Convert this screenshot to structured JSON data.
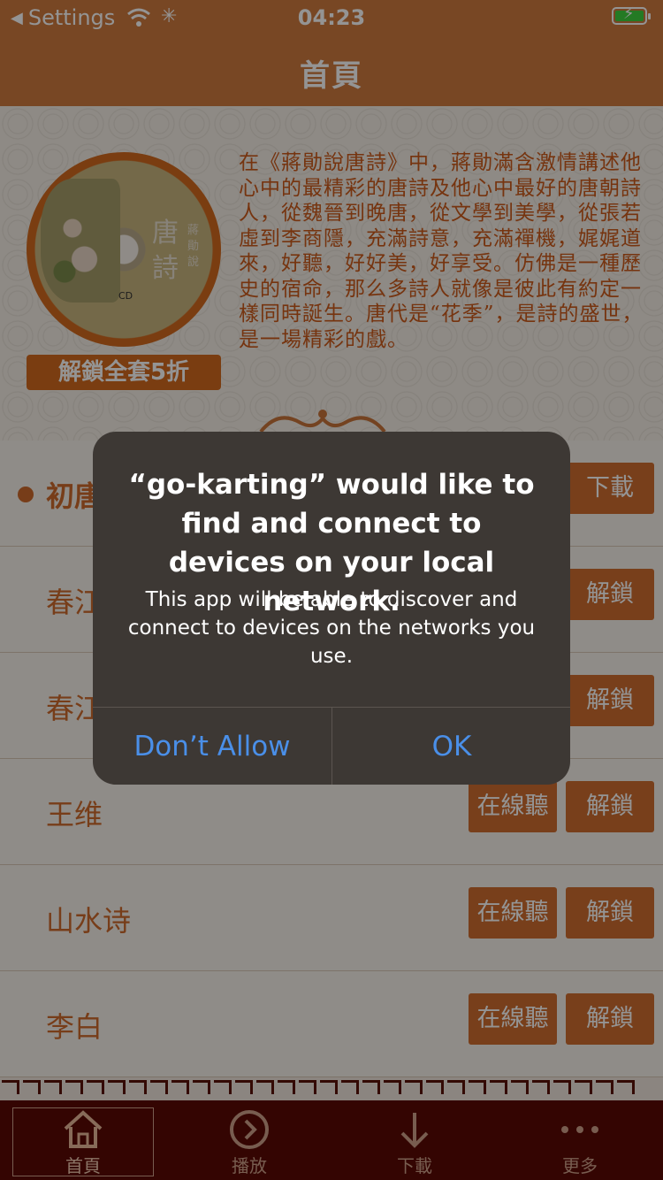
{
  "status_bar": {
    "back_label": "Settings",
    "time": "04:23"
  },
  "nav": {
    "title": "首頁"
  },
  "hero": {
    "cd_title": "唐詩",
    "cd_author": "蔣勛說",
    "cd_label": "CD",
    "unlock_label": "解鎖全套5折",
    "description": "在《蔣勛說唐詩》中，蔣勛滿含激情講述他心中的最精彩的唐詩及他心中最好的唐朝詩人，從魏晉到晚唐，從文學到美學，從張若虛到李商隱，充滿詩意，充滿禪機，娓娓道來，好聽，好好美，好享受。仿佛是一種歷史的宿命，那么多詩人就像是彼此有約定一樣同時誕生。唐代是“花季”，是詩的盛世，是一場精彩的戲。"
  },
  "list": {
    "items": [
      {
        "title": "初唐",
        "buttons": [
          "下載"
        ]
      },
      {
        "title": "春江",
        "buttons": [
          "解鎖"
        ]
      },
      {
        "title": "春江",
        "buttons": [
          "解鎖"
        ]
      },
      {
        "title": "王维",
        "buttons": [
          "在線聽",
          "解鎖"
        ]
      },
      {
        "title": "山水诗",
        "buttons": [
          "在線聽",
          "解鎖"
        ]
      },
      {
        "title": "李白",
        "buttons": [
          "在線聽",
          "解鎖"
        ]
      }
    ]
  },
  "tabbar": {
    "tabs": [
      {
        "label": "首頁",
        "icon": "home-icon"
      },
      {
        "label": "播放",
        "icon": "play-circle-icon"
      },
      {
        "label": "下載",
        "icon": "download-arrow-icon"
      },
      {
        "label": "更多",
        "icon": "more-dots-icon"
      }
    ]
  },
  "alert": {
    "title": "“go-karting” would like to find and connect to devices on your local network.",
    "message": "This app will be able to discover and connect to devices on the networks you use.",
    "deny_label": "Don’t Allow",
    "ok_label": "OK"
  },
  "colors": {
    "brand": "#cf7a3f",
    "button": "#cf6d2f",
    "tabbar": "#5a0a04",
    "alert_button_text": "#4a8fe8"
  }
}
